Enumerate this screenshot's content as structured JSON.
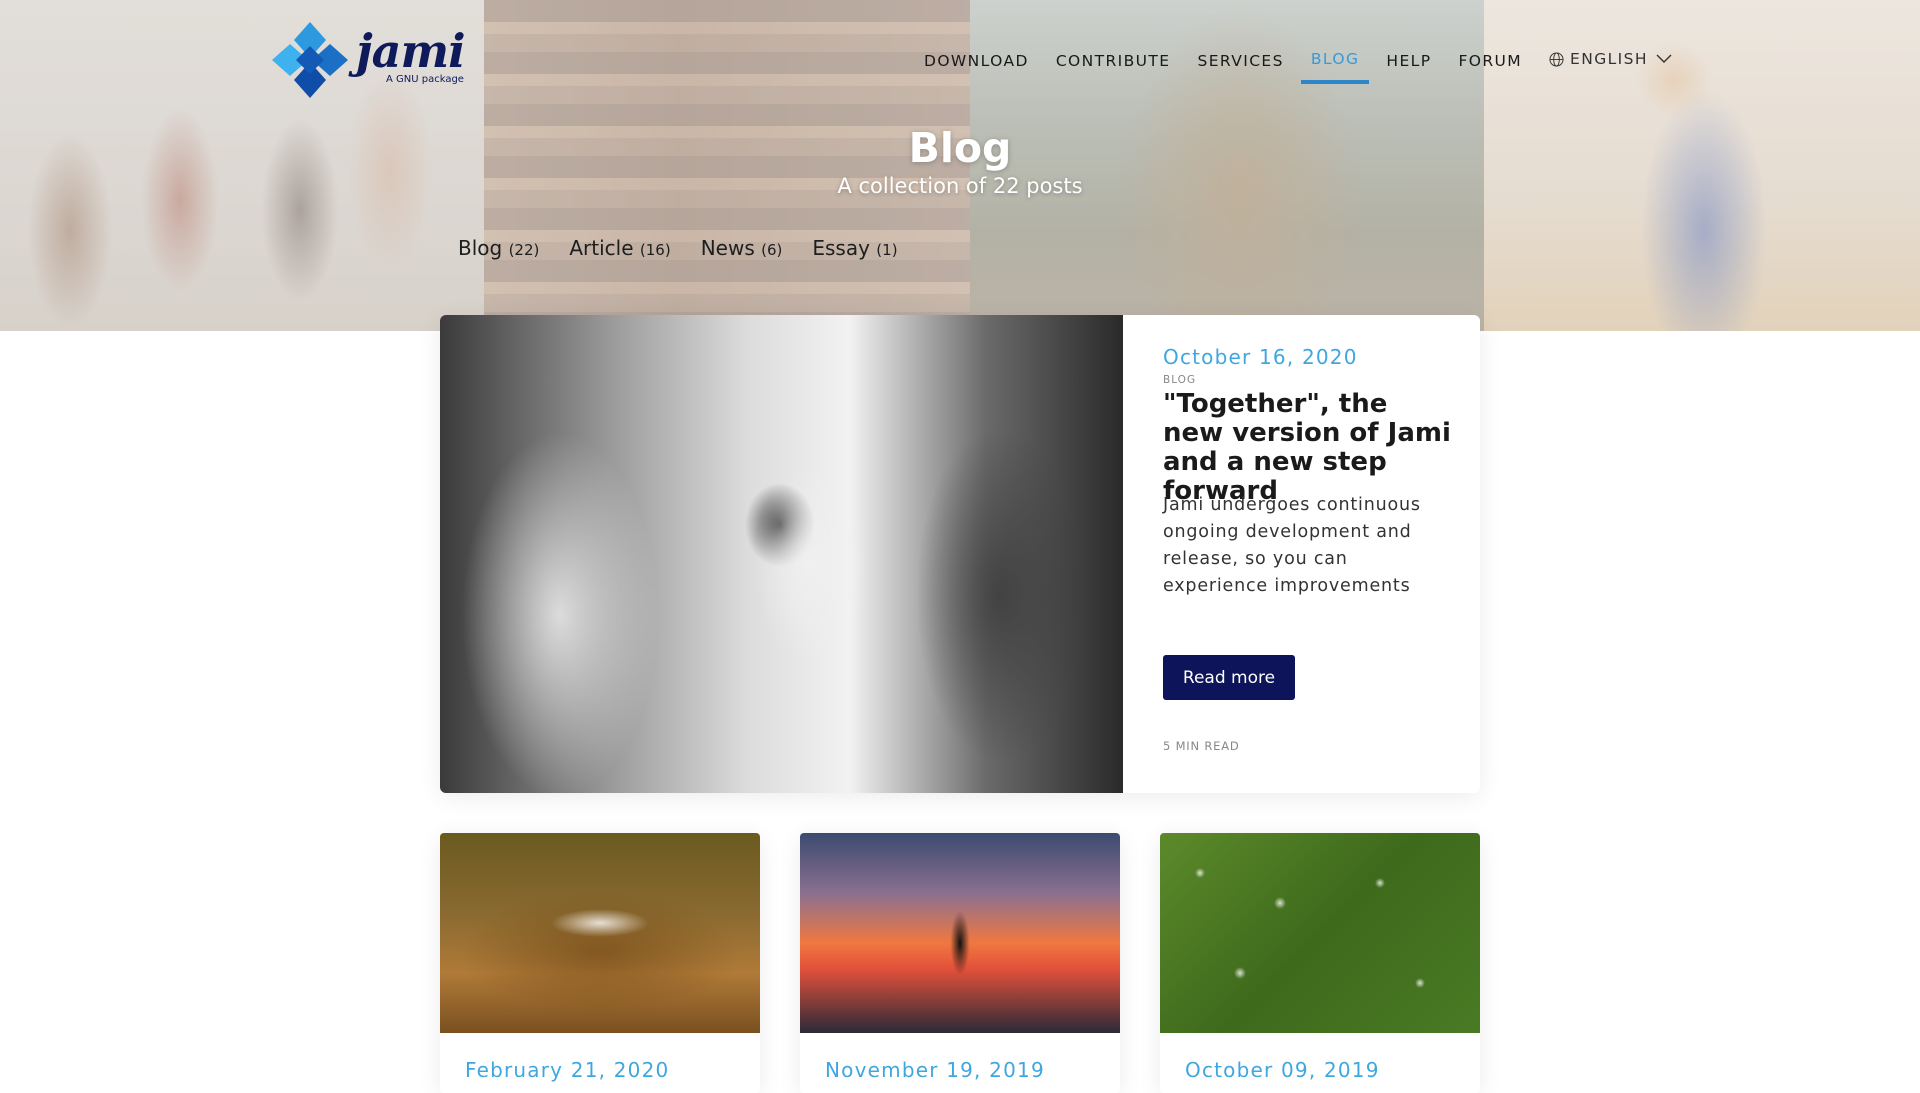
{
  "header": {
    "logo_text": "jami",
    "logo_tagline": "A GNU package",
    "nav": [
      {
        "label": "DOWNLOAD"
      },
      {
        "label": "CONTRIBUTE"
      },
      {
        "label": "SERVICES"
      },
      {
        "label": "BLOG",
        "active": true
      },
      {
        "label": "HELP"
      },
      {
        "label": "FORUM"
      }
    ],
    "language": "ENGLISH"
  },
  "hero": {
    "title": "Blog",
    "subtitle": "A collection of 22 posts"
  },
  "categories": [
    {
      "name": "Blog",
      "count": "(22)"
    },
    {
      "name": "Article",
      "count": "(16)"
    },
    {
      "name": "News",
      "count": "(6)"
    },
    {
      "name": "Essay",
      "count": "(1)"
    }
  ],
  "featured": {
    "date": "October 16, 2020",
    "tag": "BLOG",
    "title": "\"Together\", the new version of Jami and a new step forward",
    "excerpt": "Jami undergoes continuous ongoing development and release, so you can experience improvements",
    "button": "Read more",
    "read_time": "5 MIN READ"
  },
  "posts": [
    {
      "date": "February 21, 2020"
    },
    {
      "date": "November 19, 2019"
    },
    {
      "date": "October 09, 2019"
    }
  ],
  "colors": {
    "accent": "#3fa7e0",
    "nav_active": "#2e86c8",
    "button": "#0d1459",
    "logo": "#0f1a5b"
  }
}
